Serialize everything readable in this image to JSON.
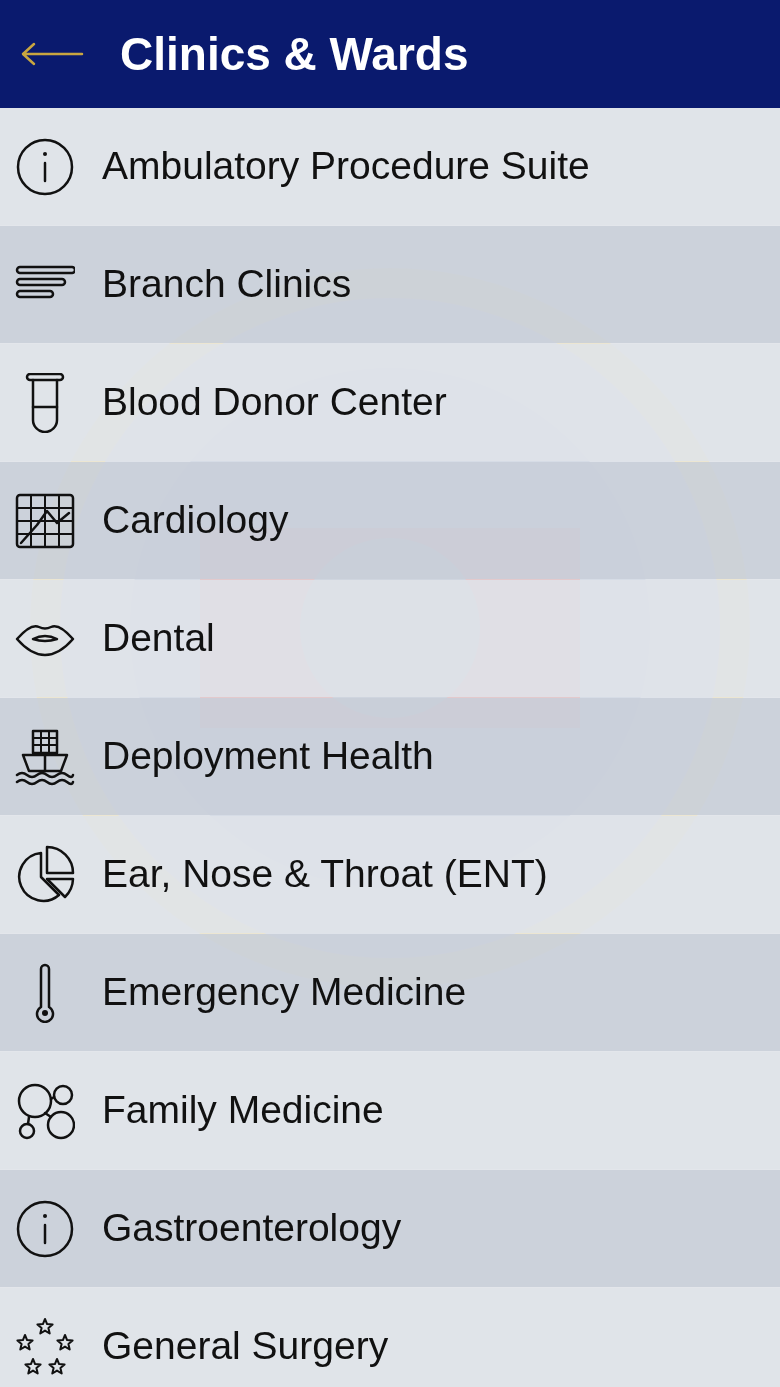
{
  "header": {
    "title": "Clinics & Wards"
  },
  "items": [
    {
      "label": "Ambulatory Procedure Suite"
    },
    {
      "label": "Branch Clinics"
    },
    {
      "label": "Blood Donor Center"
    },
    {
      "label": "Cardiology"
    },
    {
      "label": "Dental"
    },
    {
      "label": "Deployment Health"
    },
    {
      "label": "Ear, Nose & Throat (ENT)"
    },
    {
      "label": "Emergency Medicine"
    },
    {
      "label": "Family Medicine"
    },
    {
      "label": "Gastroenterology"
    },
    {
      "label": "General Surgery"
    }
  ]
}
